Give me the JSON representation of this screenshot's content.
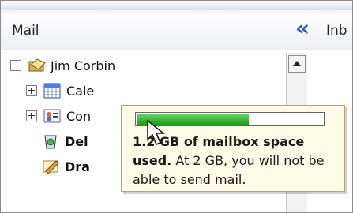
{
  "mail_pane": {
    "title": "Mail",
    "collapse_icon": "double-chevron-left-icon",
    "tree": [
      {
        "label": "Jim Corbin",
        "icon": "open-folder-icon",
        "expander": "minus",
        "bold": false
      },
      {
        "label": "Cale",
        "icon": "calendar-icon",
        "expander": "plus",
        "bold": false
      },
      {
        "label": "Con",
        "icon": "contacts-icon",
        "expander": "plus",
        "bold": false
      },
      {
        "label": "Del",
        "icon": "deleted-items-icon",
        "expander": "",
        "bold": true
      },
      {
        "label": "Dra",
        "icon": "drafts-icon",
        "expander": "",
        "bold": true
      }
    ]
  },
  "inbox_pane": {
    "title": "Inb"
  },
  "tooltip": {
    "usage_fraction": 0.6,
    "bold_text": "1.2 GB of mailbox space used.",
    "rest_text": " At 2 GB, you will not be able to send mail."
  },
  "colors": {
    "accent": "#3456b8",
    "progress": "#17a017",
    "tooltip_bg": "#fffbe7"
  }
}
